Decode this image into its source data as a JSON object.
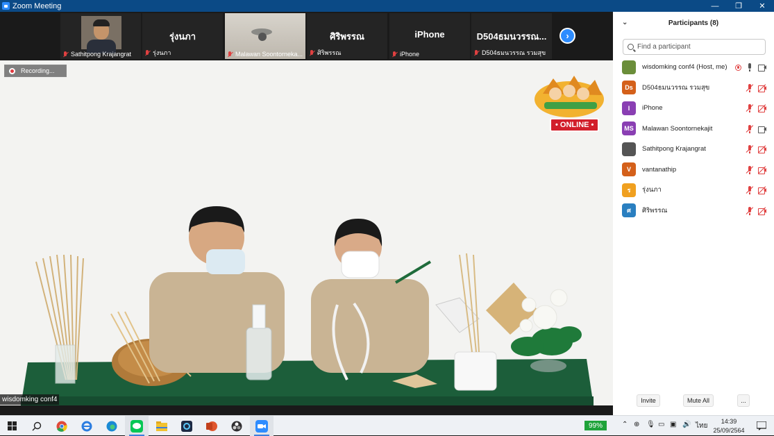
{
  "window": {
    "title": "Zoom Meeting"
  },
  "thumbnails": [
    {
      "big_name": "",
      "caption": "Sathitpong Krajangrat",
      "kind": "camera"
    },
    {
      "big_name": "รุ่งนภา",
      "caption": "รุ่งนภา",
      "kind": "name"
    },
    {
      "big_name": "",
      "caption": "Malawan Soontornekа...",
      "kind": "ceiling"
    },
    {
      "big_name": "ศิริพรรณ",
      "caption": "ศิริพรรณ",
      "kind": "name"
    },
    {
      "big_name": "iPhone",
      "caption": "iPhone",
      "kind": "name"
    },
    {
      "big_name": "D504ธมนวรรณ...",
      "caption": "D504ธมนวรรณ รวมสุข",
      "kind": "name"
    }
  ],
  "main_video": {
    "recording_label": "Recording...",
    "speaker_label": "wisdomking conf4",
    "logo_badge": "ONLINE"
  },
  "participants_panel": {
    "title": "Participants (8)",
    "search_placeholder": "Find a participant",
    "participants": [
      {
        "name": "wisdomking conf4 (Host, me)",
        "initials": "",
        "color": "#6b8e3a",
        "mic": "on",
        "cam": "on",
        "rec": true
      },
      {
        "name": "D504ธมนวรรณ รวมสุข",
        "initials": "Ds",
        "color": "#d4601a",
        "mic": "off",
        "cam": "off",
        "rec": false
      },
      {
        "name": "iPhone",
        "initials": "I",
        "color": "#8a3fb3",
        "mic": "off",
        "cam": "off",
        "rec": false
      },
      {
        "name": "Malawan Soontornekajit",
        "initials": "MS",
        "color": "#8a3fb3",
        "mic": "off",
        "cam": "on",
        "rec": false
      },
      {
        "name": "Sathitpong Krajangrat",
        "initials": "",
        "color": "#555555",
        "mic": "off",
        "cam": "off",
        "rec": false
      },
      {
        "name": "vantanathip",
        "initials": "V",
        "color": "#d4601a",
        "mic": "off",
        "cam": "off",
        "rec": false
      },
      {
        "name": "รุ่งนภา",
        "initials": "ร",
        "color": "#f0a020",
        "mic": "off",
        "cam": "off",
        "rec": false
      },
      {
        "name": "ศิริพรรณ",
        "initials": "ศ",
        "color": "#2a7fc0",
        "mic": "off",
        "cam": "off",
        "rec": false
      }
    ],
    "buttons": {
      "invite": "Invite",
      "mute_all": "Mute All",
      "more": "..."
    }
  },
  "taskbar": {
    "battery": "99%",
    "language": "ไทย",
    "time": "14:39",
    "date": "25/09/2564"
  }
}
